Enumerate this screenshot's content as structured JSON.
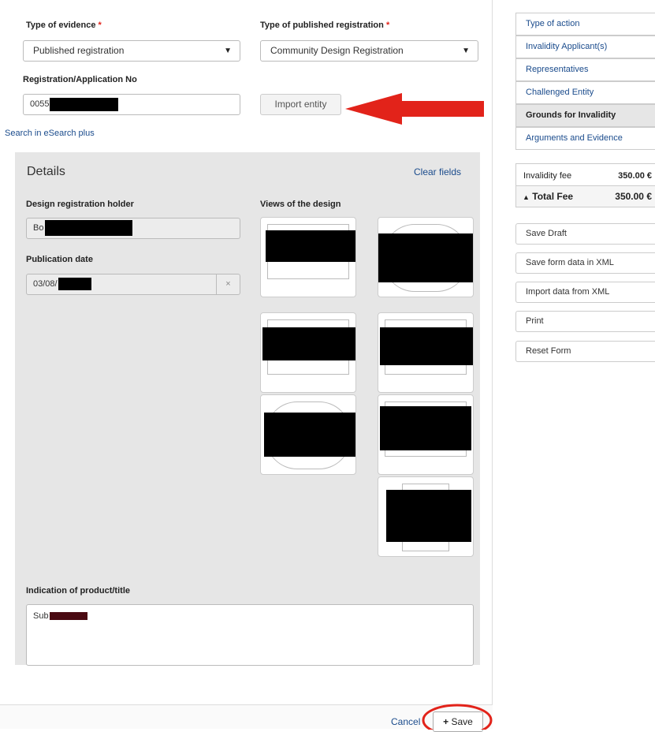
{
  "form": {
    "evidence_type_label": "Type of evidence",
    "evidence_type_value": "Published registration",
    "pub_reg_label": "Type of published registration",
    "pub_reg_value": "Community Design Registration",
    "required_mark": "*",
    "reg_no_label": "Registration/Application No",
    "reg_no_value": "0055",
    "import_label": "Import entity",
    "esearch_link": "Search in eSearch plus"
  },
  "details": {
    "title": "Details",
    "clear_fields": "Clear fields",
    "holder_label": "Design registration holder",
    "holder_value": "Bo",
    "pub_date_label": "Publication date",
    "pub_date_value": "03/08/",
    "clear_x": "×",
    "views_label": "Views of the design",
    "product_label": "Indication of product/title",
    "product_value": "Sub"
  },
  "footer": {
    "cancel": "Cancel",
    "save": "Save",
    "save_icon": "plus-icon"
  },
  "sidebar": {
    "nav": [
      {
        "label": "Type of action",
        "active": false
      },
      {
        "label": "Invalidity Applicant(s)",
        "active": false
      },
      {
        "label": "Representatives",
        "active": false
      },
      {
        "label": "Challenged Entity",
        "active": false
      },
      {
        "label": "Grounds for Invalidity",
        "active": true
      },
      {
        "label": "Arguments and Evidence",
        "active": false
      }
    ],
    "fee_label": "Invalidity fee",
    "fee_value": "350.00 €",
    "total_label": "Total Fee",
    "total_value": "350.00 €",
    "actions": [
      "Save Draft",
      "Save form data in XML",
      "Import data from XML",
      "Print",
      "Reset Form"
    ]
  },
  "colors": {
    "required": "#e2231a",
    "link": "#1a4b8c",
    "annotation": "#e2231a"
  }
}
